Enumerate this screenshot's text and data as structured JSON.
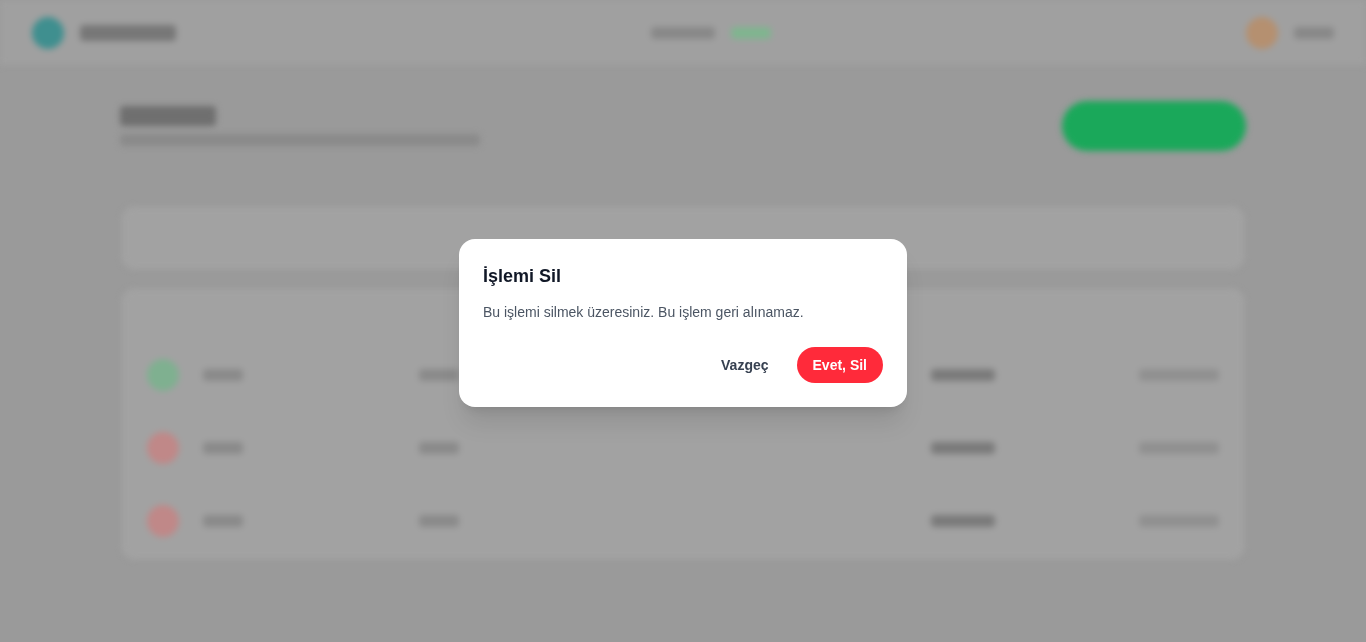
{
  "dialog": {
    "title": "İşlemi Sil",
    "message": "Bu işlemi silmek üzeresiniz. Bu işlem geri alınamaz.",
    "buttons": [
      {
        "label": "Vazgeç",
        "kind": "cancel"
      },
      {
        "label": "Evet, Sil",
        "kind": "danger"
      }
    ]
  }
}
